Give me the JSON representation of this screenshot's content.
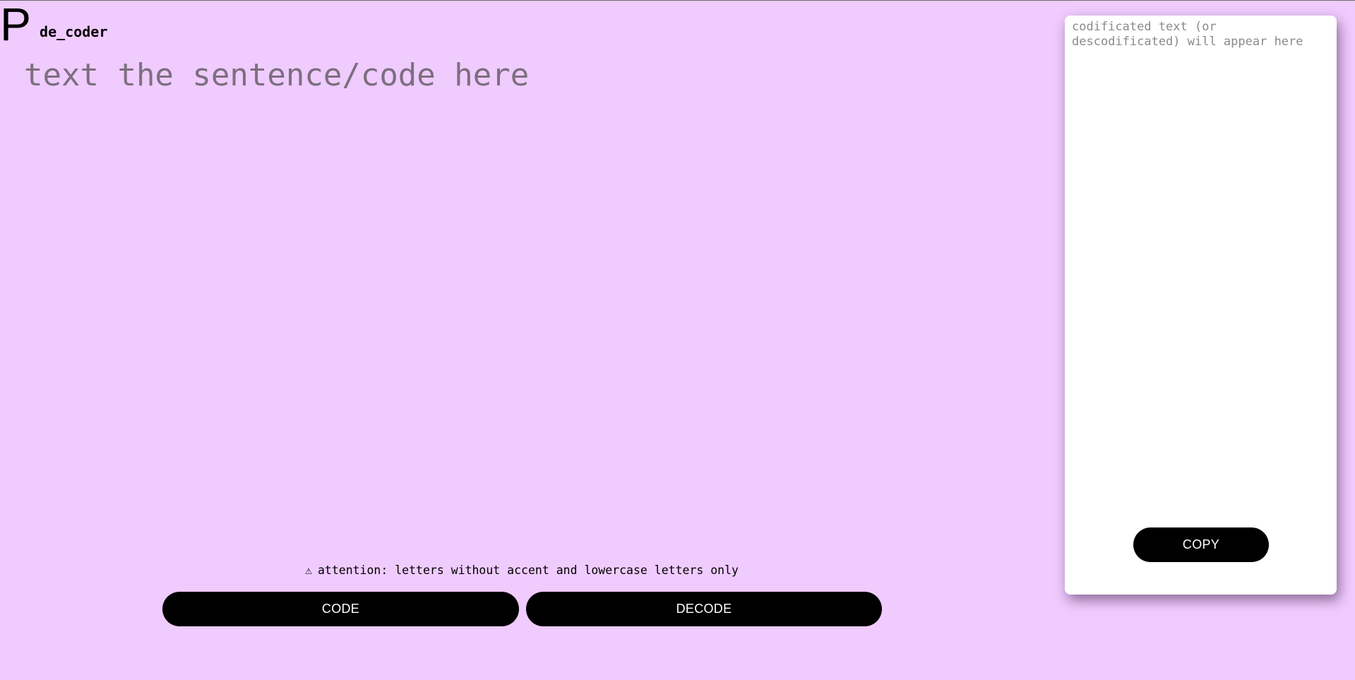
{
  "logo": {
    "letter": "P",
    "rest": "de_coder"
  },
  "input": {
    "placeholder": "text the sentence/code here",
    "value": ""
  },
  "warning": {
    "icon": "⚠",
    "text": "attention: letters without accent and lowercase letters only"
  },
  "buttons": {
    "code": "CODE",
    "decode": "DECODE",
    "copy": "COPY"
  },
  "output": {
    "placeholder": "codificated text (or descodificated) will appear here",
    "value": ""
  },
  "colors": {
    "background": "#f0cbfe",
    "button": "#000000",
    "panel": "#ffffff"
  }
}
